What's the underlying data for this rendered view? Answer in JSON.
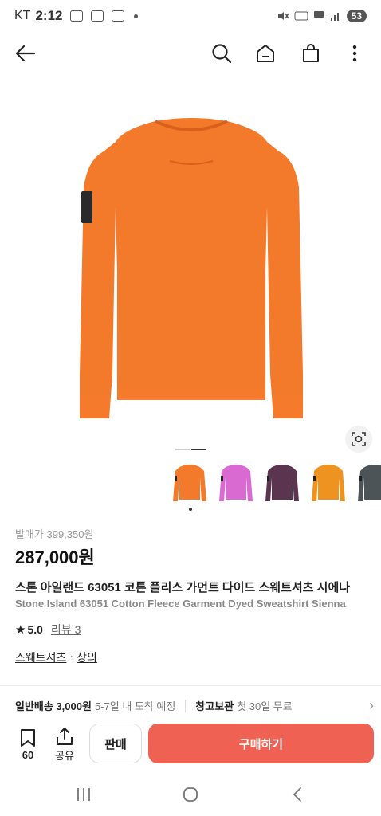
{
  "status_bar": {
    "carrier": "KT",
    "time": "2:12",
    "battery": "53"
  },
  "nav": {
    "back_icon": "arrow-left-icon",
    "search_icon": "search-icon",
    "home_icon": "home-icon",
    "cart_icon": "shopping-bag-icon",
    "more_icon": "more-vertical-icon"
  },
  "product": {
    "color": "#f47a2b",
    "thumbnails": [
      {
        "color": "#f47a2b"
      },
      {
        "color": "#d96ad1"
      },
      {
        "color": "#5b3450"
      },
      {
        "color": "#ee9320"
      },
      {
        "color": "#4c5457"
      }
    ],
    "original_price": "발매가 399,350원",
    "price": "287,000원",
    "title_ko": "스톤 아일랜드 63051 코튼 플리스 가먼트 다이드 스웨트셔츠 시에나",
    "title_en": "Stone Island 63051 Cotton Fleece Garment Dyed Sweatshirt Sienna",
    "rating": "5.0",
    "review_label": "리뷰 3",
    "category": "스웨트셔츠",
    "category_sep": "·",
    "subcategory": "상의"
  },
  "delivery": {
    "standard_label": "일반배송 3,000원",
    "standard_eta": "5-7일 내 도착 예정",
    "storage_label": "창고보관",
    "storage_note": "첫 30일 무료"
  },
  "actions": {
    "wish_count": "60",
    "share_label": "공유",
    "sell_label": "판매",
    "buy_label": "구매하기"
  },
  "colors": {
    "accent": "#ef6253"
  }
}
